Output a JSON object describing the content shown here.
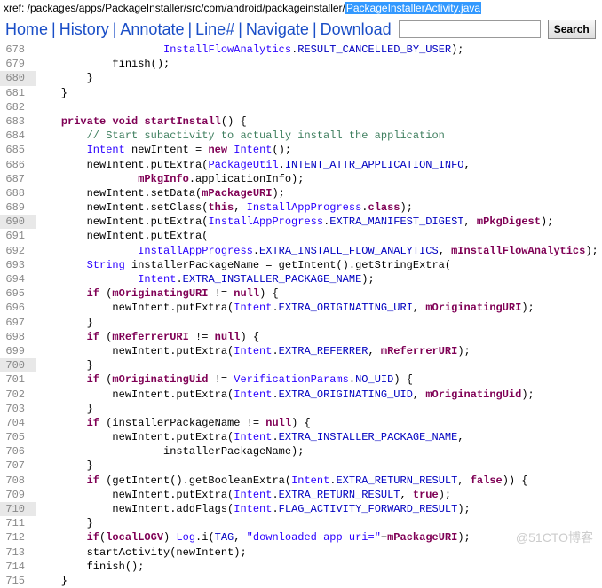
{
  "xref": {
    "prefix": "xref: ",
    "path": "/packages/apps/PackageInstaller/src/com/android/packageinstaller/",
    "file": "PackageInstallerActivity.java"
  },
  "nav": {
    "home": "Home",
    "history": "History",
    "annotate": "Annotate",
    "line": "Line#",
    "navigate": "Navigate",
    "download": "Download",
    "search_placeholder": "",
    "search_btn": "Search"
  },
  "code": {
    "lines": [
      {
        "n": "678",
        "hl": false,
        "html": "                    <span class='type'>InstallFlowAnalytics</span>.<span class='field'>RESULT_CANCELLED_BY_USER</span>);"
      },
      {
        "n": "679",
        "hl": false,
        "html": "            finish();"
      },
      {
        "n": "680",
        "hl": true,
        "html": "        }"
      },
      {
        "n": "681",
        "hl": false,
        "html": "    }"
      },
      {
        "n": "682",
        "hl": false,
        "html": ""
      },
      {
        "n": "683",
        "hl": false,
        "html": "    <span class='kw'>private</span> <span class='kw'>void</span> <span class='fn'>startInstall</span>() {"
      },
      {
        "n": "684",
        "hl": false,
        "html": "        <span class='cmt'>// Start subactivity to actually install the application</span>"
      },
      {
        "n": "685",
        "hl": false,
        "html": "        <span class='type'>Intent</span> newIntent = <span class='kw'>new</span> <span class='type'>Intent</span>();"
      },
      {
        "n": "686",
        "hl": false,
        "html": "        newIntent.putExtra(<span class='type'>PackageUtil</span>.<span class='field'>INTENT_ATTR_APPLICATION_INFO</span>,"
      },
      {
        "n": "687",
        "hl": false,
        "html": "                <span class='mfield'>mPkgInfo</span>.applicationInfo);"
      },
      {
        "n": "688",
        "hl": false,
        "html": "        newIntent.setData(<span class='mfield'>mPackageURI</span>);"
      },
      {
        "n": "689",
        "hl": false,
        "html": "        newIntent.setClass(<span class='kw'>this</span>, <span class='type'>InstallAppProgress</span>.<span class='kw'>class</span>);"
      },
      {
        "n": "690",
        "hl": true,
        "html": "        newIntent.putExtra(<span class='type'>InstallAppProgress</span>.<span class='field'>EXTRA_MANIFEST_DIGEST</span>, <span class='mfield'>mPkgDigest</span>);"
      },
      {
        "n": "691",
        "hl": false,
        "html": "        newIntent.putExtra("
      },
      {
        "n": "692",
        "hl": false,
        "html": "                <span class='type'>InstallAppProgress</span>.<span class='field'>EXTRA_INSTALL_FLOW_ANALYTICS</span>, <span class='mfield'>mInstallFlowAnalytics</span>);"
      },
      {
        "n": "693",
        "hl": false,
        "html": "        <span class='type'>String</span> installerPackageName = getIntent().getStringExtra("
      },
      {
        "n": "694",
        "hl": false,
        "html": "                <span class='type'>Intent</span>.<span class='field'>EXTRA_INSTALLER_PACKAGE_NAME</span>);"
      },
      {
        "n": "695",
        "hl": false,
        "html": "        <span class='kw'>if</span> (<span class='mfield'>mOriginatingURI</span> != <span class='kw'>null</span>) {"
      },
      {
        "n": "696",
        "hl": false,
        "html": "            newIntent.putExtra(<span class='type'>Intent</span>.<span class='field'>EXTRA_ORIGINATING_URI</span>, <span class='mfield'>mOriginatingURI</span>);"
      },
      {
        "n": "697",
        "hl": false,
        "html": "        }"
      },
      {
        "n": "698",
        "hl": false,
        "html": "        <span class='kw'>if</span> (<span class='mfield'>mReferrerURI</span> != <span class='kw'>null</span>) {"
      },
      {
        "n": "699",
        "hl": false,
        "html": "            newIntent.putExtra(<span class='type'>Intent</span>.<span class='field'>EXTRA_REFERRER</span>, <span class='mfield'>mReferrerURI</span>);"
      },
      {
        "n": "700",
        "hl": true,
        "html": "        }"
      },
      {
        "n": "701",
        "hl": false,
        "html": "        <span class='kw'>if</span> (<span class='mfield'>mOriginatingUid</span> != <span class='type'>VerificationParams</span>.<span class='field'>NO_UID</span>) {"
      },
      {
        "n": "702",
        "hl": false,
        "html": "            newIntent.putExtra(<span class='type'>Intent</span>.<span class='field'>EXTRA_ORIGINATING_UID</span>, <span class='mfield'>mOriginatingUid</span>);"
      },
      {
        "n": "703",
        "hl": false,
        "html": "        }"
      },
      {
        "n": "704",
        "hl": false,
        "html": "        <span class='kw'>if</span> (installerPackageName != <span class='kw'>null</span>) {"
      },
      {
        "n": "705",
        "hl": false,
        "html": "            newIntent.putExtra(<span class='type'>Intent</span>.<span class='field'>EXTRA_INSTALLER_PACKAGE_NAME</span>,"
      },
      {
        "n": "706",
        "hl": false,
        "html": "                    installerPackageName);"
      },
      {
        "n": "707",
        "hl": false,
        "html": "        }"
      },
      {
        "n": "708",
        "hl": false,
        "html": "        <span class='kw'>if</span> (getIntent().getBooleanExtra(<span class='type'>Intent</span>.<span class='field'>EXTRA_RETURN_RESULT</span>, <span class='kw'>false</span>)) {"
      },
      {
        "n": "709",
        "hl": false,
        "html": "            newIntent.putExtra(<span class='type'>Intent</span>.<span class='field'>EXTRA_RETURN_RESULT</span>, <span class='kw'>true</span>);"
      },
      {
        "n": "710",
        "hl": true,
        "html": "            newIntent.addFlags(<span class='type'>Intent</span>.<span class='field'>FLAG_ACTIVITY_FORWARD_RESULT</span>);"
      },
      {
        "n": "711",
        "hl": false,
        "html": "        }"
      },
      {
        "n": "712",
        "hl": false,
        "html": "        <span class='kw'>if</span>(<span class='mfield'>localLOGV</span>) <span class='type'>Log</span>.i(<span class='field'>TAG</span>, <span class='str'>\"downloaded app uri=\"</span>+<span class='mfield'>mPackageURI</span>);"
      },
      {
        "n": "713",
        "hl": false,
        "html": "        startActivity(newIntent);"
      },
      {
        "n": "714",
        "hl": false,
        "html": "        finish();"
      },
      {
        "n": "715",
        "hl": false,
        "html": "    }"
      }
    ]
  },
  "watermark": "@51CTO博客"
}
